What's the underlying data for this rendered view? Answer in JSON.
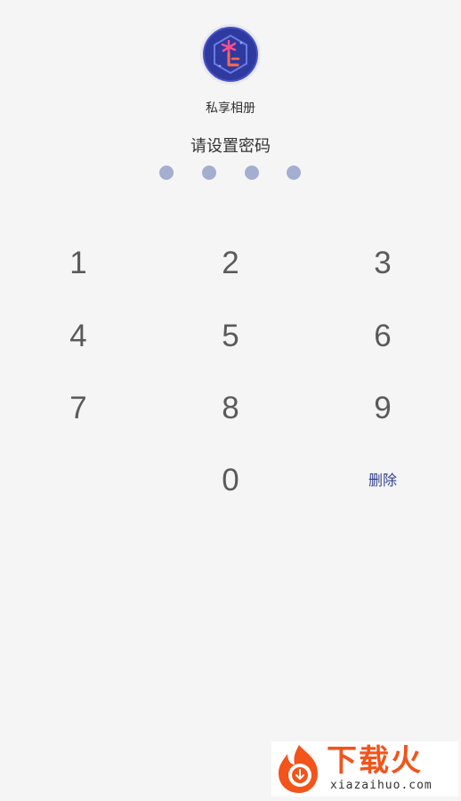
{
  "app": {
    "name": "私享相册",
    "icon": "app-logo-icon"
  },
  "prompt": "请设置密码",
  "passcode": {
    "length": 4,
    "dot_color": "#a3aed1"
  },
  "keypad": {
    "keys": [
      "1",
      "2",
      "3",
      "4",
      "5",
      "6",
      "7",
      "8",
      "9",
      "0"
    ],
    "delete_label": "删除",
    "delete_color": "#2f3f8f"
  },
  "watermark": {
    "title": "下载火",
    "subtitle": "xiazaihuo.com",
    "color": "#f2541b"
  }
}
